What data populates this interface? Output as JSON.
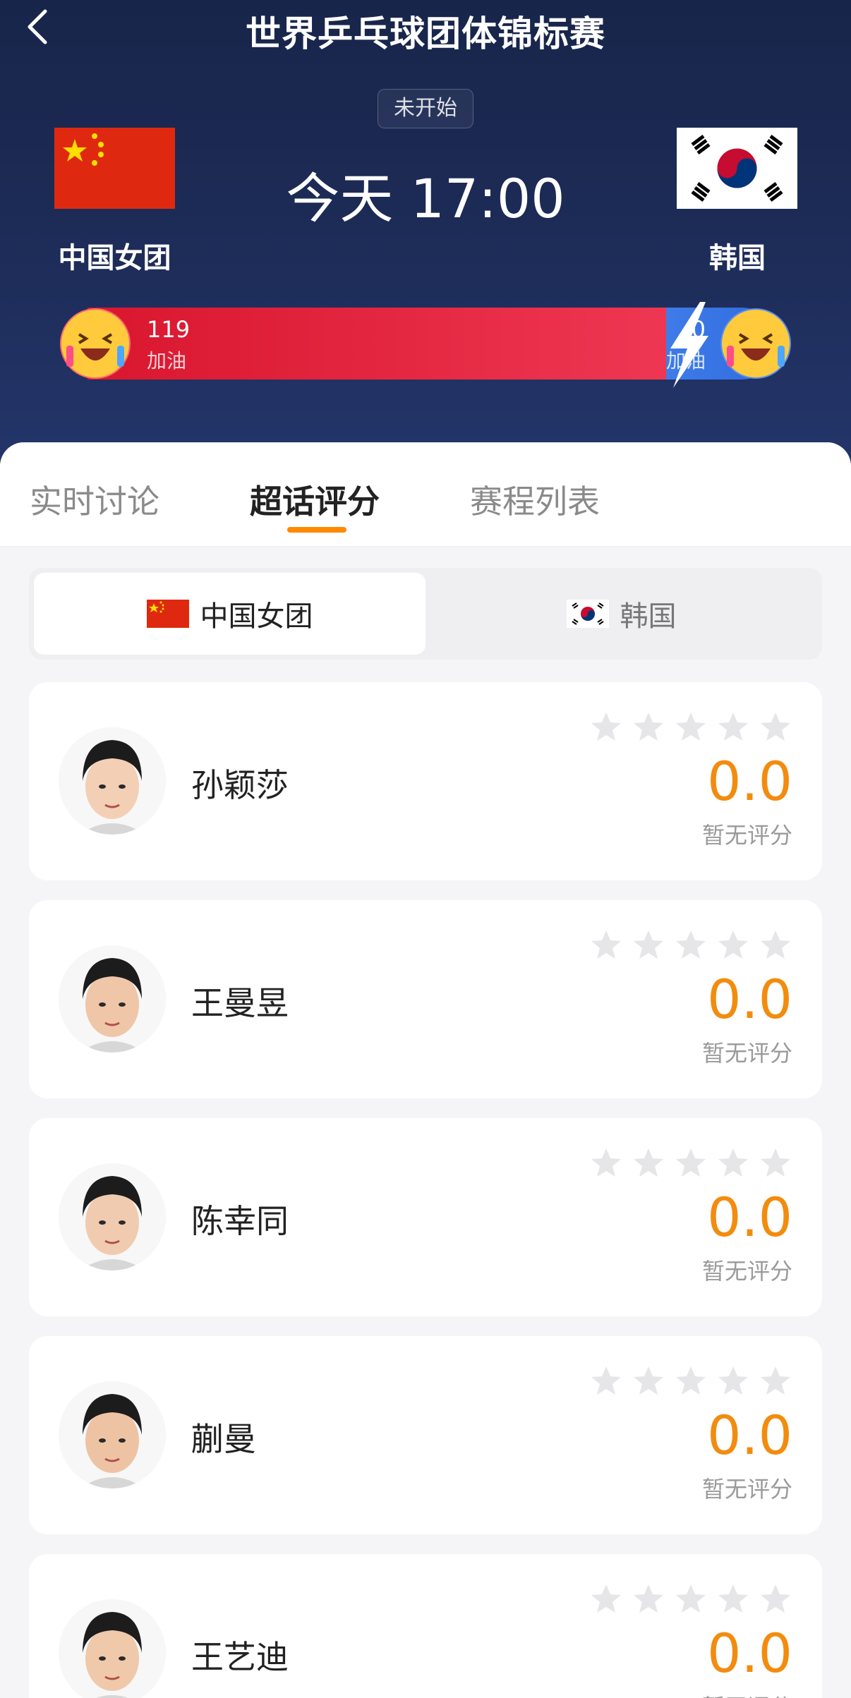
{
  "header": {
    "title": "世界乒乓球团体锦标赛",
    "status": "未开始",
    "match_time": "今天 17:00",
    "team_home": "中国女团",
    "team_away": "韩国"
  },
  "support": {
    "home_count": "119",
    "home_label": "加油",
    "away_count": "0",
    "away_label": "加油",
    "home_color": "#e21f3a",
    "away_color": "#3a74e6"
  },
  "tabs": [
    {
      "label": "实时讨论"
    },
    {
      "label": "超话评分"
    },
    {
      "label": "赛程列表"
    }
  ],
  "active_tab": "超话评分",
  "team_toggle": {
    "selected": "中国女团",
    "other": "韩国"
  },
  "players": [
    {
      "name": "孙颖莎",
      "score": "0.0",
      "note": "暂无评分",
      "stars_filled": 0
    },
    {
      "name": "王曼昱",
      "score": "0.0",
      "note": "暂无评分",
      "stars_filled": 0
    },
    {
      "name": "陈幸同",
      "score": "0.0",
      "note": "暂无评分",
      "stars_filled": 0
    },
    {
      "name": "蒯曼",
      "score": "0.0",
      "note": "暂无评分",
      "stars_filled": 0
    },
    {
      "name": "王艺迪",
      "score": "0.0",
      "note": "暂无评分",
      "stars_filled": 0
    }
  ],
  "colors": {
    "accent": "#f28c0f",
    "header_bg": "#1b2a52"
  }
}
